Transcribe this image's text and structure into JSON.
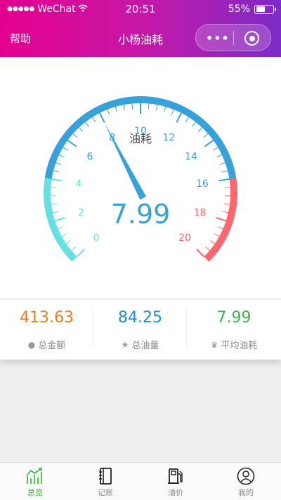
{
  "status_bar": {
    "carrier": "WeChat",
    "time": "20:51",
    "battery": "55%",
    "battery_level": 0.55
  },
  "nav": {
    "left_link": "帮助",
    "title": "小杨油耗"
  },
  "gauge": {
    "title": "油耗",
    "value": 7.99,
    "value_text": "7.99",
    "min": 0,
    "max": 20,
    "tick_labels": [
      "0",
      "2",
      "4",
      "6",
      "8",
      "10",
      "12",
      "14",
      "16",
      "18",
      "20"
    ],
    "color_bands": [
      {
        "to_fraction": 0.2,
        "color": "#67e0e3"
      },
      {
        "to_fraction": 0.8,
        "color": "#37a2da"
      },
      {
        "to_fraction": 1.0,
        "color": "#fd666d"
      }
    ]
  },
  "stats": [
    {
      "value": "413.63",
      "label": "总金额",
      "icon": "coin-icon",
      "color": "#f07a1f"
    },
    {
      "value": "84.25",
      "label": "总油量",
      "icon": "star-icon",
      "color": "#1d8ae6"
    },
    {
      "value": "7.99",
      "label": "平均油耗",
      "icon": "crown-icon",
      "color": "#3db34a"
    }
  ],
  "tabs": [
    {
      "label": "总览",
      "icon": "chart-icon",
      "active": true
    },
    {
      "label": "记账",
      "icon": "notebook-icon",
      "active": false
    },
    {
      "label": "油价",
      "icon": "fuel-pump-icon",
      "active": false
    },
    {
      "label": "我的",
      "icon": "user-icon",
      "active": false
    }
  ],
  "colors": {
    "active_tab": "#2ab52a",
    "header_gradient": [
      "#e5008f",
      "#7d2bc8"
    ]
  }
}
